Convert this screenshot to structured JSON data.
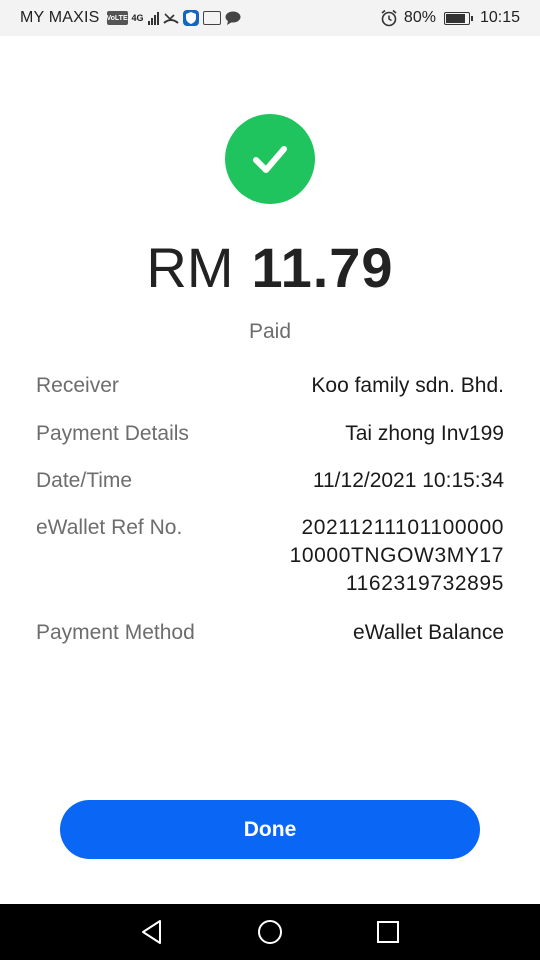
{
  "status_bar": {
    "carrier": "MY MAXIS",
    "volte_badge": "VoLTE",
    "network_type": "4G",
    "battery_percent": "80%",
    "battery_level": 0.8,
    "time": "10:15",
    "icons": [
      "volte-icon",
      "signal-icon",
      "missed-call-icon",
      "shield-icon",
      "nfc-icon",
      "message-icon",
      "alarm-icon",
      "battery-icon"
    ]
  },
  "receipt": {
    "success_icon": "checkmark-icon",
    "currency": "RM",
    "amount": "11.79",
    "status": "Paid",
    "receiver_label": "Receiver",
    "receiver_value": "Koo family sdn. Bhd.",
    "payment_details_label": "Payment Details",
    "payment_details_value": "Tai zhong Inv199",
    "datetime_label": "Date/Time",
    "datetime_value": "11/12/2021 10:15:34",
    "ref_label": "eWallet Ref No.",
    "ref_value_lines": [
      "20211211101100000",
      "10000TNGOW3MY17",
      "1162319732895"
    ],
    "method_label": "Payment Method",
    "method_value": "eWallet Balance"
  },
  "actions": {
    "done_label": "Done"
  },
  "nav_bar": {
    "icons": [
      "back-icon",
      "home-icon",
      "recents-icon"
    ]
  },
  "colors": {
    "success_green": "#20c45e",
    "primary_blue": "#0a67f5",
    "muted_text": "#6d6d6d"
  }
}
